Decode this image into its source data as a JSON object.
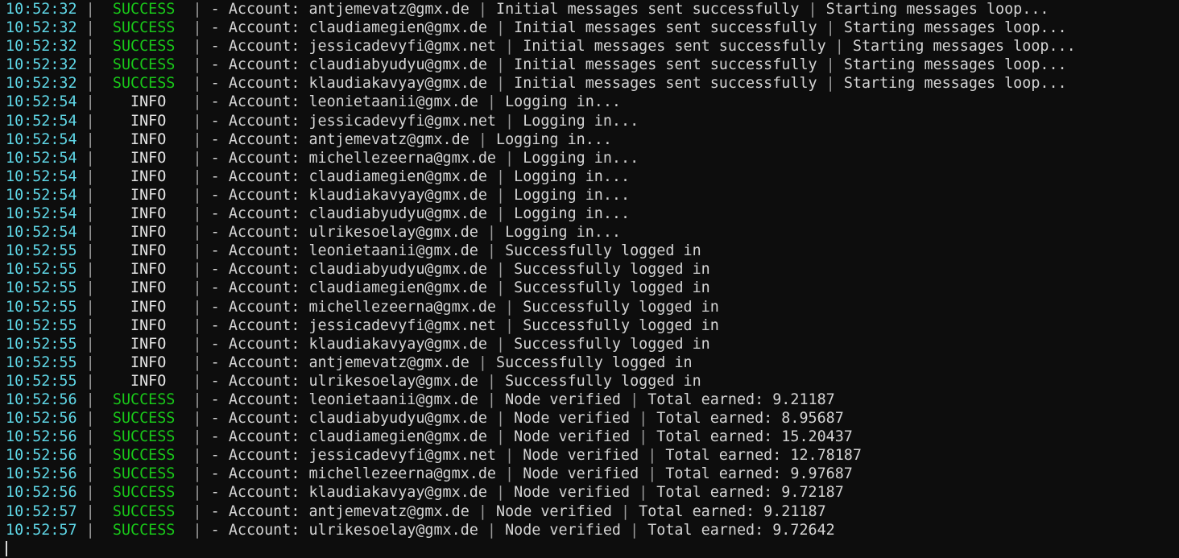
{
  "terminal": {
    "background_color": "#0d0d0d",
    "timestamp_color": "#5fd7e7",
    "success_color": "#19c819",
    "info_color": "#e6e6e6",
    "message_color": "#d4d4d4",
    "separator_color": "#9a9a9a",
    "separator": "|",
    "prefix": "- Account:",
    "field_separator": "|",
    "cursor_visible": true
  },
  "log_lines": [
    {
      "time": "10:52:32",
      "level": "SUCCESS",
      "account": "antjemevatz@gmx.de",
      "fields": [
        "Initial messages sent successfully",
        "Starting messages loop..."
      ]
    },
    {
      "time": "10:52:32",
      "level": "SUCCESS",
      "account": "claudiamegien@gmx.de",
      "fields": [
        "Initial messages sent successfully",
        "Starting messages loop..."
      ]
    },
    {
      "time": "10:52:32",
      "level": "SUCCESS",
      "account": "jessicadevyfi@gmx.net",
      "fields": [
        "Initial messages sent successfully",
        "Starting messages loop..."
      ]
    },
    {
      "time": "10:52:32",
      "level": "SUCCESS",
      "account": "claudiabyudyu@gmx.de",
      "fields": [
        "Initial messages sent successfully",
        "Starting messages loop..."
      ]
    },
    {
      "time": "10:52:32",
      "level": "SUCCESS",
      "account": "klaudiakavyay@gmx.de",
      "fields": [
        "Initial messages sent successfully",
        "Starting messages loop..."
      ]
    },
    {
      "time": "10:52:54",
      "level": "INFO",
      "account": "leonietaanii@gmx.de",
      "fields": [
        "Logging in..."
      ]
    },
    {
      "time": "10:52:54",
      "level": "INFO",
      "account": "jessicadevyfi@gmx.net",
      "fields": [
        "Logging in..."
      ]
    },
    {
      "time": "10:52:54",
      "level": "INFO",
      "account": "antjemevatz@gmx.de",
      "fields": [
        "Logging in..."
      ]
    },
    {
      "time": "10:52:54",
      "level": "INFO",
      "account": "michellezeerna@gmx.de",
      "fields": [
        "Logging in..."
      ]
    },
    {
      "time": "10:52:54",
      "level": "INFO",
      "account": "claudiamegien@gmx.de",
      "fields": [
        "Logging in..."
      ]
    },
    {
      "time": "10:52:54",
      "level": "INFO",
      "account": "klaudiakavyay@gmx.de",
      "fields": [
        "Logging in..."
      ]
    },
    {
      "time": "10:52:54",
      "level": "INFO",
      "account": "claudiabyudyu@gmx.de",
      "fields": [
        "Logging in..."
      ]
    },
    {
      "time": "10:52:54",
      "level": "INFO",
      "account": "ulrikesoelay@gmx.de",
      "fields": [
        "Logging in..."
      ]
    },
    {
      "time": "10:52:55",
      "level": "INFO",
      "account": "leonietaanii@gmx.de",
      "fields": [
        "Successfully logged in"
      ]
    },
    {
      "time": "10:52:55",
      "level": "INFO",
      "account": "claudiabyudyu@gmx.de",
      "fields": [
        "Successfully logged in"
      ]
    },
    {
      "time": "10:52:55",
      "level": "INFO",
      "account": "claudiamegien@gmx.de",
      "fields": [
        "Successfully logged in"
      ]
    },
    {
      "time": "10:52:55",
      "level": "INFO",
      "account": "michellezeerna@gmx.de",
      "fields": [
        "Successfully logged in"
      ]
    },
    {
      "time": "10:52:55",
      "level": "INFO",
      "account": "jessicadevyfi@gmx.net",
      "fields": [
        "Successfully logged in"
      ]
    },
    {
      "time": "10:52:55",
      "level": "INFO",
      "account": "klaudiakavyay@gmx.de",
      "fields": [
        "Successfully logged in"
      ]
    },
    {
      "time": "10:52:55",
      "level": "INFO",
      "account": "antjemevatz@gmx.de",
      "fields": [
        "Successfully logged in"
      ]
    },
    {
      "time": "10:52:55",
      "level": "INFO",
      "account": "ulrikesoelay@gmx.de",
      "fields": [
        "Successfully logged in"
      ]
    },
    {
      "time": "10:52:56",
      "level": "SUCCESS",
      "account": "leonietaanii@gmx.de",
      "fields": [
        "Node verified",
        "Total earned: 9.21187"
      ]
    },
    {
      "time": "10:52:56",
      "level": "SUCCESS",
      "account": "claudiabyudyu@gmx.de",
      "fields": [
        "Node verified",
        "Total earned: 8.95687"
      ]
    },
    {
      "time": "10:52:56",
      "level": "SUCCESS",
      "account": "claudiamegien@gmx.de",
      "fields": [
        "Node verified",
        "Total earned: 15.20437"
      ]
    },
    {
      "time": "10:52:56",
      "level": "SUCCESS",
      "account": "jessicadevyfi@gmx.net",
      "fields": [
        "Node verified",
        "Total earned: 12.78187"
      ]
    },
    {
      "time": "10:52:56",
      "level": "SUCCESS",
      "account": "michellezeerna@gmx.de",
      "fields": [
        "Node verified",
        "Total earned: 9.97687"
      ]
    },
    {
      "time": "10:52:56",
      "level": "SUCCESS",
      "account": "klaudiakavyay@gmx.de",
      "fields": [
        "Node verified",
        "Total earned: 9.72187"
      ]
    },
    {
      "time": "10:52:57",
      "level": "SUCCESS",
      "account": "antjemevatz@gmx.de",
      "fields": [
        "Node verified",
        "Total earned: 9.21187"
      ]
    },
    {
      "time": "10:52:57",
      "level": "SUCCESS",
      "account": "ulrikesoelay@gmx.de",
      "fields": [
        "Node verified",
        "Total earned: 9.72642"
      ]
    }
  ]
}
